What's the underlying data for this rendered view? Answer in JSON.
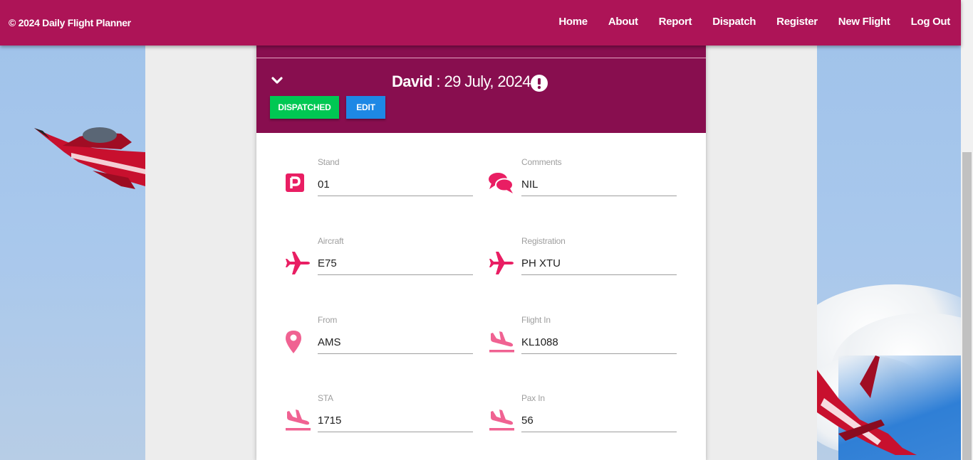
{
  "brand": "© 2024 Daily Flight Planner",
  "nav": [
    "Home",
    "About",
    "Report",
    "Dispatch",
    "Register",
    "New Flight",
    "Log Out"
  ],
  "header": {
    "name": "David",
    "separator": " : ",
    "date": "29 July, 2024"
  },
  "buttons": {
    "dispatched": "DISPATCHED",
    "edit": "EDIT"
  },
  "fields": {
    "stand": {
      "label": "Stand",
      "value": "01"
    },
    "comments": {
      "label": "Comments",
      "value": "NIL"
    },
    "aircraft": {
      "label": "Aircraft",
      "value": "E75"
    },
    "registration": {
      "label": "Registration",
      "value": "PH XTU"
    },
    "from": {
      "label": "From",
      "value": "AMS"
    },
    "flight_in": {
      "label": "Flight In",
      "value": "KL1088"
    },
    "sta": {
      "label": "STA",
      "value": "1715"
    },
    "pax_in": {
      "label": "Pax In",
      "value": "56"
    }
  },
  "colors": {
    "navbar": "#ad1457",
    "card_header": "#880e4f",
    "accent": "#e91e63",
    "dispatched": "#00c853",
    "edit": "#1e88e5"
  },
  "icons": [
    "chevron-down-icon",
    "alert-circle-icon",
    "parking-icon",
    "comments-icon",
    "airplane-icon",
    "map-marker-icon",
    "plane-arrival-icon"
  ]
}
